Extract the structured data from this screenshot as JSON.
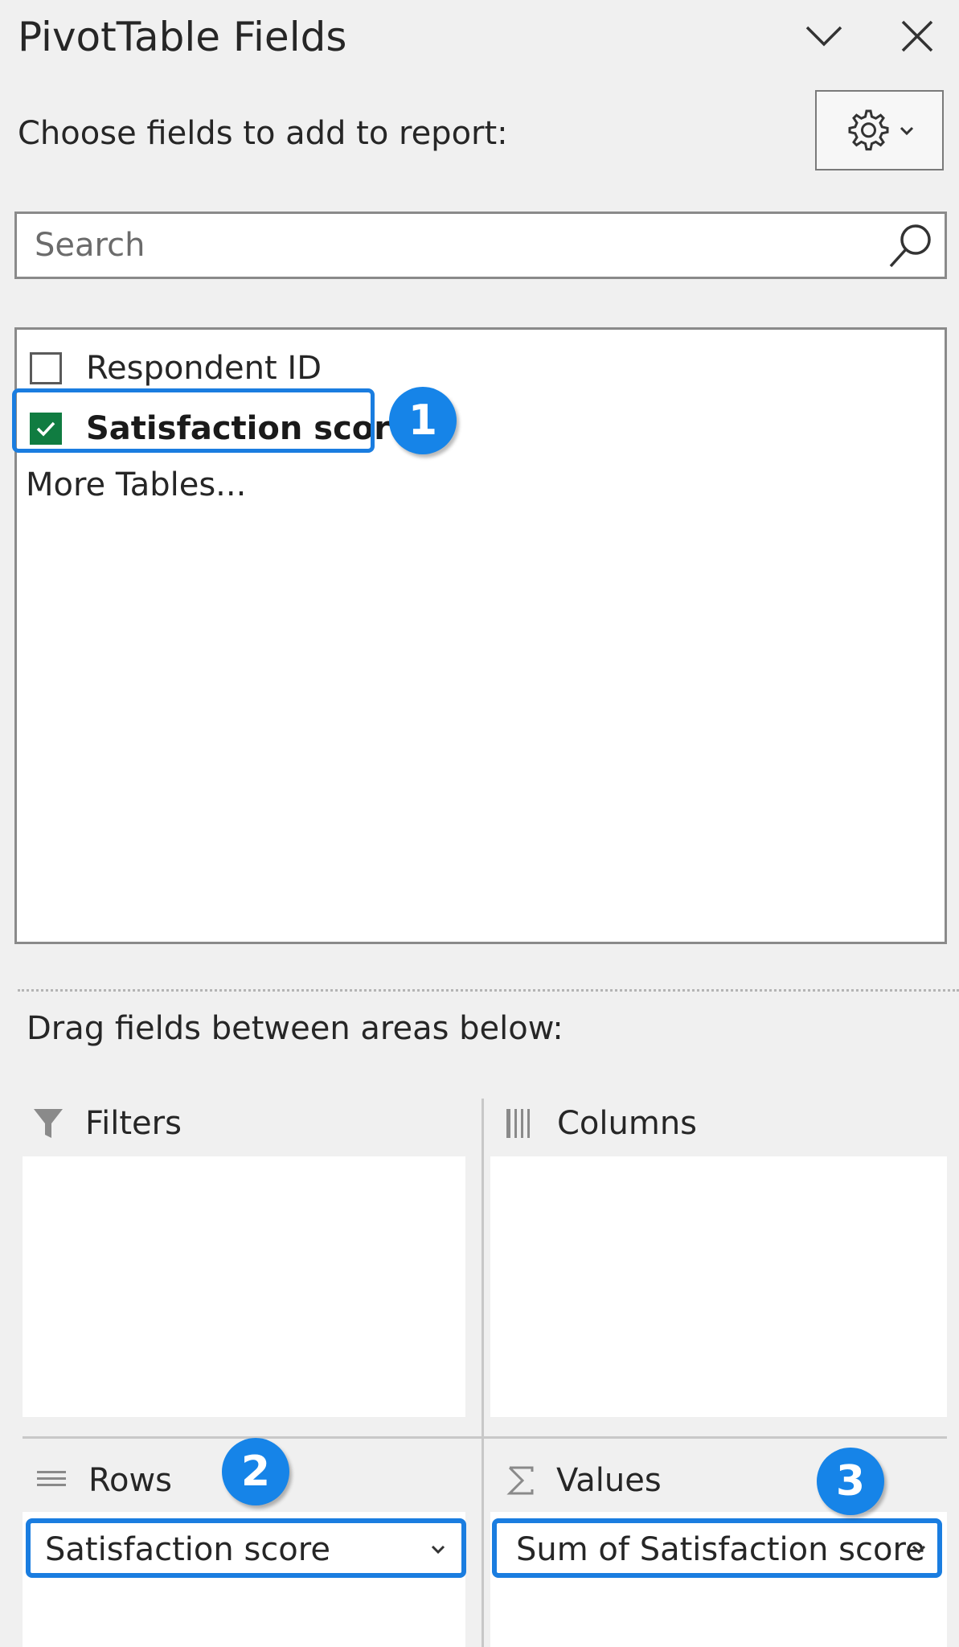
{
  "header": {
    "title": "PivotTable Fields",
    "subtitle": "Choose fields to add to report:"
  },
  "search": {
    "placeholder": "Search",
    "value": ""
  },
  "fields": [
    {
      "label": "Respondent ID",
      "checked": false
    },
    {
      "label": "Satisfaction score",
      "checked": true
    }
  ],
  "more_tables": "More Tables...",
  "drag_label": "Drag fields between areas below:",
  "areas": {
    "filters": {
      "label": "Filters"
    },
    "columns": {
      "label": "Columns"
    },
    "rows": {
      "label": "Rows",
      "item": "Satisfaction score"
    },
    "values": {
      "label": "Values",
      "item": "Sum of Satisfaction score"
    }
  },
  "callouts": [
    "1",
    "2",
    "3"
  ],
  "colors": {
    "accent_blue": "#1684e8",
    "checkbox_green": "#107c41"
  },
  "icons": [
    "chevron-down-icon",
    "close-icon",
    "gear-icon",
    "search-icon",
    "filter-icon",
    "columns-icon",
    "rows-icon",
    "sigma-icon"
  ]
}
